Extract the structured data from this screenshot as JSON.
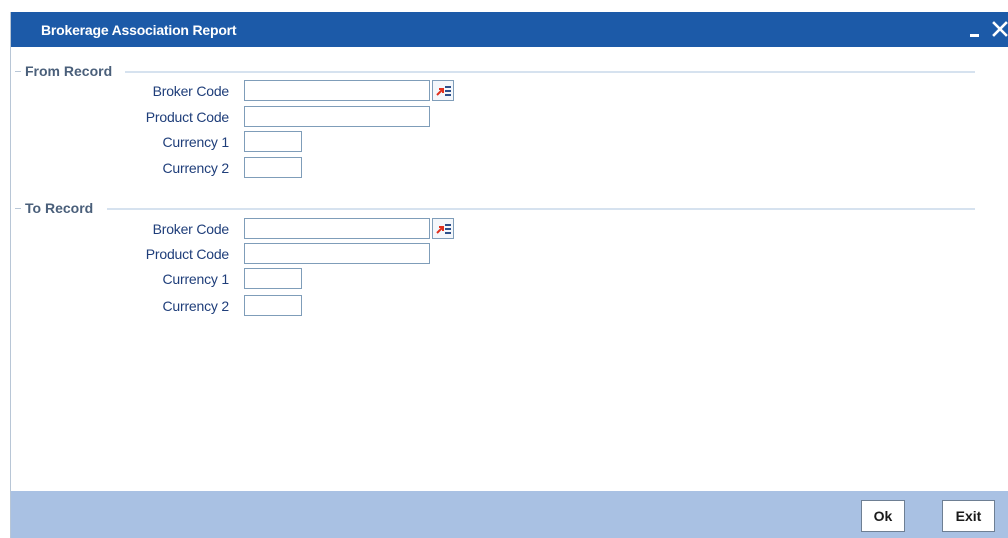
{
  "window": {
    "title": "Brokerage Association Report",
    "minimize_icon": "minimize-icon",
    "close_icon": "close-icon"
  },
  "from_record": {
    "legend": "From Record",
    "broker_code": {
      "label": "Broker Code",
      "value": ""
    },
    "product_code": {
      "label": "Product Code",
      "value": ""
    },
    "currency1": {
      "label": "Currency 1",
      "value": ""
    },
    "currency2": {
      "label": "Currency 2",
      "value": ""
    }
  },
  "to_record": {
    "legend": "To Record",
    "broker_code": {
      "label": "Broker Code",
      "value": ""
    },
    "product_code": {
      "label": "Product Code",
      "value": ""
    },
    "currency1": {
      "label": "Currency 1",
      "value": ""
    },
    "currency2": {
      "label": "Currency 2",
      "value": ""
    }
  },
  "footer": {
    "ok_label": "Ok",
    "exit_label": "Exit"
  },
  "colors": {
    "titlebar": "#1c5aa8",
    "footer": "#a9c1e3",
    "label_text": "#1f3e7a"
  }
}
